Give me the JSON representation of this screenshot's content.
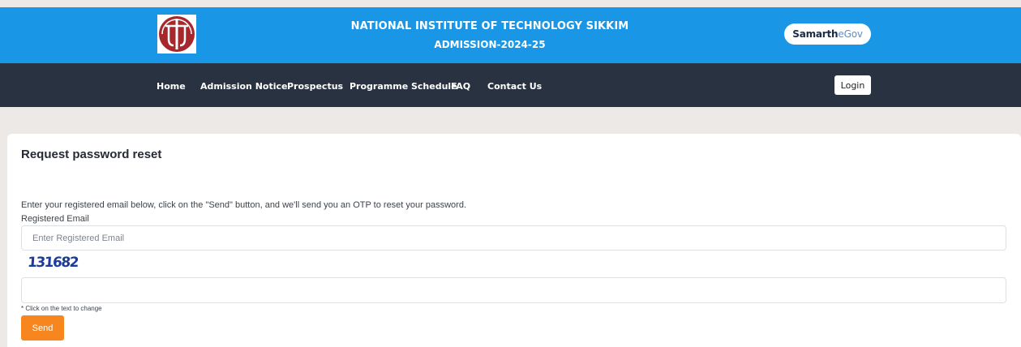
{
  "header": {
    "institute_name": "NATIONAL INSTITUTE OF TECHNOLOGY SIKKIM",
    "admission_title": "ADMISSION-2024-25",
    "brand_part1": "Samarth",
    "brand_part2": "eGov",
    "logo_icon": "nit-sikkim-logo-icon"
  },
  "nav": {
    "items": [
      {
        "label": "Home"
      },
      {
        "label": "Admission Notice"
      },
      {
        "label": "Prospectus"
      },
      {
        "label": "Programme Schedule"
      },
      {
        "label": "FAQ"
      },
      {
        "label": "Contact Us"
      }
    ],
    "login_label": "Login"
  },
  "form": {
    "title": "Request password reset",
    "instructions": "Enter your registered email below, click on the \"Send\" button, and we'll send you an OTP to reset your password.",
    "email_label": "Registered Email",
    "email_placeholder": "Enter Registered Email",
    "captcha_text": "131682",
    "captcha_value": "",
    "captcha_hint": "* Click on the text to change",
    "send_label": "Send"
  },
  "colors": {
    "header_blue": "#1a96e6",
    "nav_dark": "#283241",
    "send_orange": "#f7861f",
    "logo_red": "#a6282c",
    "captcha_blue": "#1a3d9c"
  }
}
